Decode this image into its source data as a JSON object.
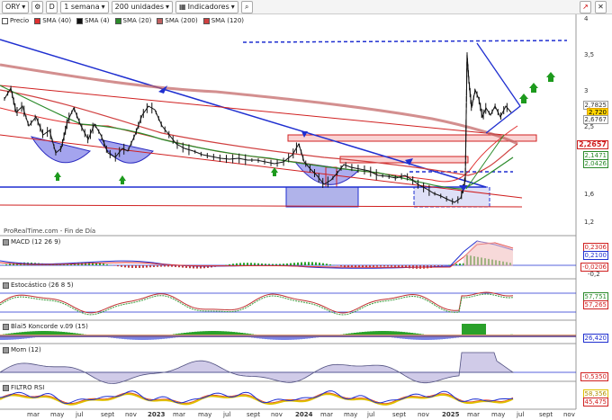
{
  "toolbar": {
    "symbol": "ORY",
    "period": "1 semana",
    "units": "200 unidades",
    "indicators": "Indicadores",
    "d_label": "D"
  },
  "legend": {
    "price": "Precio",
    "sma40": "SMA (40)",
    "sma4": "SMA (4)",
    "sma20": "SMA (20)",
    "sma200": "SMA (200)",
    "sma120": "SMA (120)"
  },
  "colors": {
    "sma40": "#e03030",
    "sma4": "#111111",
    "sma20": "#2a8a2a",
    "sma200": "#c06060",
    "sma120": "#d04040",
    "trend": "#1f2fd0"
  },
  "source": "ProRealTime.com - Fin de Día",
  "price_axis": {
    "ticks": [
      "4",
      "3,5",
      "3",
      "2,5",
      "2",
      "1,6",
      "1,2"
    ]
  },
  "price_tags": {
    "a": "2,7825",
    "b": "2,720",
    "c": "2,6767",
    "d": "2,2657",
    "e": "2,1471",
    "f": "2,0426"
  },
  "macd": {
    "label": "MACD (12 26 9)",
    "v1": "0,2306",
    "v2": "0,2100",
    "v3": "-0,0206",
    "tick": "-0,2"
  },
  "stoch": {
    "label": "Estocástico (26 8 5)",
    "v1": "57,751",
    "v2": "57,265"
  },
  "blai": {
    "label": "Blai5 Koncorde v.09 (15)",
    "v1": "26,420"
  },
  "mom": {
    "label": "Mom (12)",
    "v1": "-0,5350"
  },
  "rsi": {
    "label": "FILTRO RSI",
    "v1": "58,356",
    "v2": "45,475"
  },
  "xaxis": [
    {
      "t": "mar",
      "y": false
    },
    {
      "t": "may",
      "y": false
    },
    {
      "t": "jul",
      "y": false
    },
    {
      "t": "sept",
      "y": false
    },
    {
      "t": "nov",
      "y": false
    },
    {
      "t": "2023",
      "y": true
    },
    {
      "t": "mar",
      "y": false
    },
    {
      "t": "may",
      "y": false
    },
    {
      "t": "jul",
      "y": false
    },
    {
      "t": "sept",
      "y": false
    },
    {
      "t": "nov",
      "y": false
    },
    {
      "t": "2024",
      "y": true
    },
    {
      "t": "mar",
      "y": false
    },
    {
      "t": "may",
      "y": false
    },
    {
      "t": "jul",
      "y": false
    },
    {
      "t": "sept",
      "y": false
    },
    {
      "t": "nov",
      "y": false
    },
    {
      "t": "2025",
      "y": true
    },
    {
      "t": "mar",
      "y": false
    },
    {
      "t": "may",
      "y": false
    },
    {
      "t": "jul",
      "y": false
    },
    {
      "t": "sept",
      "y": false
    },
    {
      "t": "nov",
      "y": false
    }
  ]
}
